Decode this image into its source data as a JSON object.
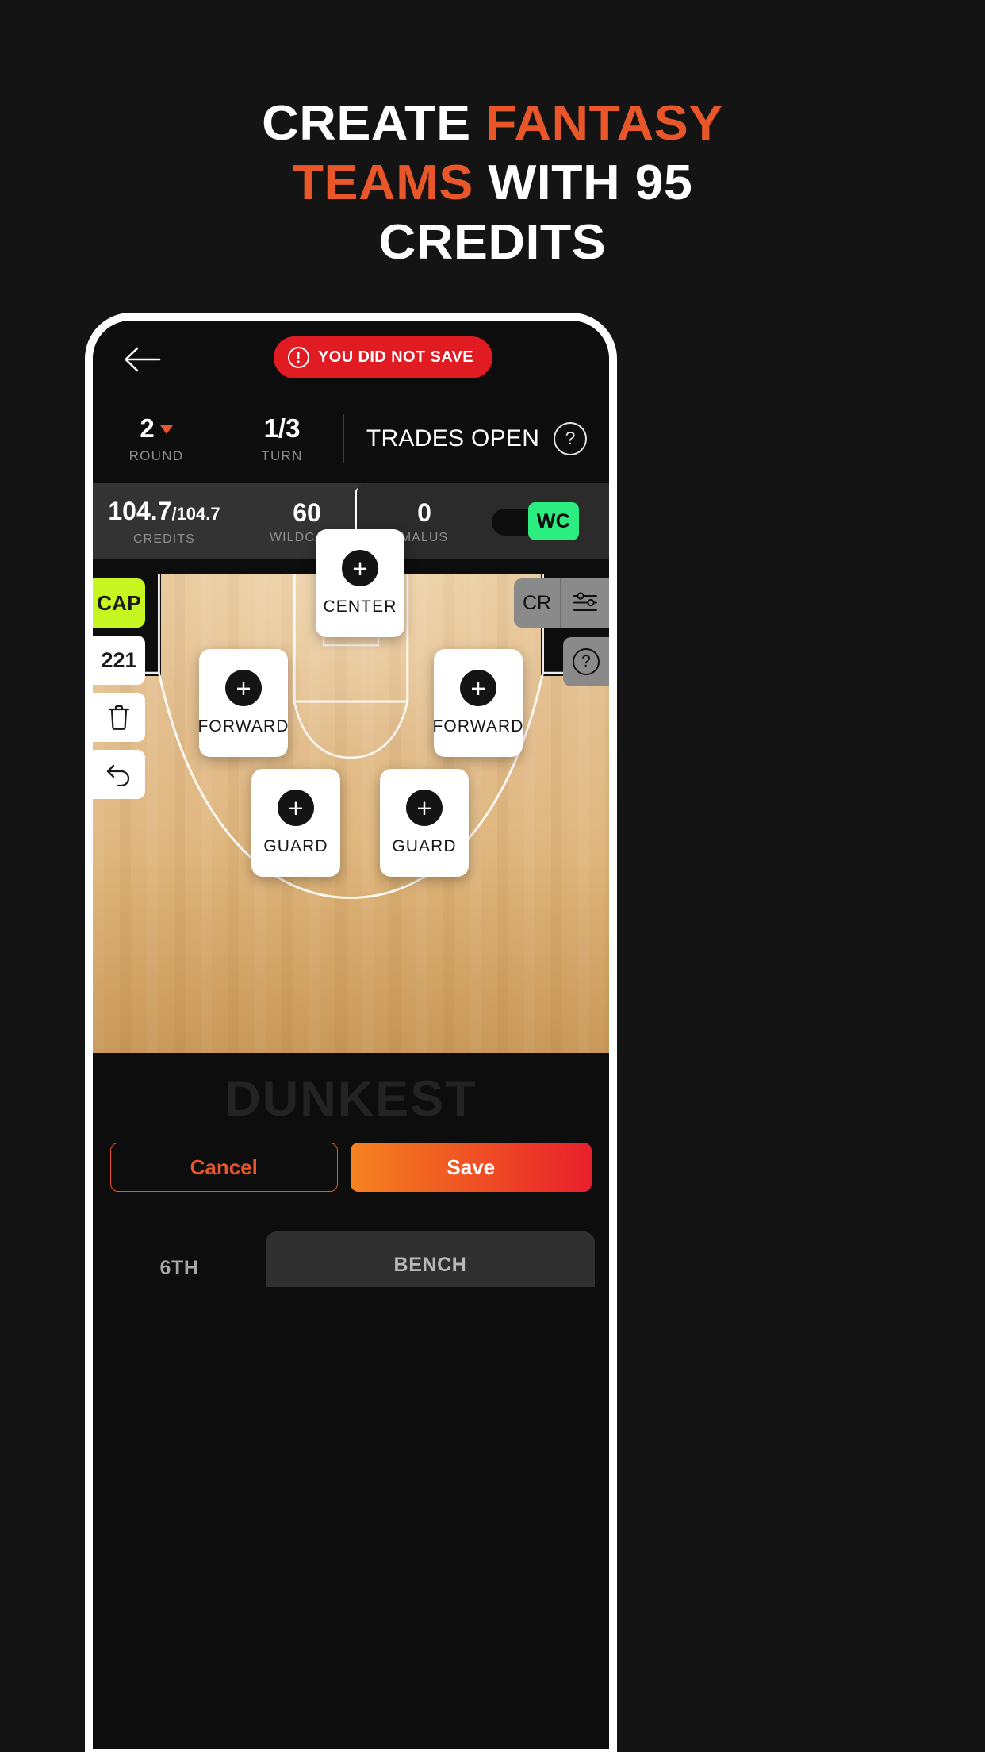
{
  "headline": {
    "line1_white": "CREATE ",
    "line1_accent": "FANTASY",
    "line2_accent": "TEAMS ",
    "line2_white": "WITH 95",
    "line3_white": "CREDITS",
    "accent_color": "#e8562a"
  },
  "app": {
    "topbar": {
      "back_icon": "back-arrow-icon",
      "save_banner": {
        "icon": "warning-icon",
        "label": "YOU DID NOT SAVE",
        "color": "#e01b22"
      }
    },
    "stats": {
      "round": {
        "value": "2",
        "label": "ROUND",
        "caret": "chevron-down-icon"
      },
      "turn": {
        "value": "1/3",
        "label": "TURN"
      },
      "trades": "TRADES OPEN",
      "help_icon": "?"
    },
    "credits": {
      "credits_value": "104.7",
      "credits_max": "/104.7",
      "credits_label": "CREDITS",
      "wildcard_value": "60",
      "wildcard_label": "WILDCARD",
      "add_button": "+",
      "malus_value": "0",
      "malus_label": "MALUS",
      "wc_toggle_label": "WC",
      "wc_toggle_color": "#2bed80"
    },
    "side_left": {
      "cap": "CAP",
      "number": "221",
      "trash_icon": "trash-icon",
      "undo_icon": "undo-icon",
      "cap_color": "#c6f622"
    },
    "side_right": {
      "cr": "CR",
      "sliders_icon": "sliders-icon",
      "help": "?"
    },
    "roster": [
      {
        "position": "center",
        "role": "CENTER",
        "add": "+"
      },
      {
        "position": "forward_left",
        "role": "FORWARD",
        "add": "+"
      },
      {
        "position": "forward_right",
        "role": "FORWARD",
        "add": "+"
      },
      {
        "position": "guard_left",
        "role": "GUARD",
        "add": "+"
      },
      {
        "position": "guard_right",
        "role": "GUARD",
        "add": "+"
      }
    ],
    "watermark": "DUNKEST",
    "footer": {
      "cancel": "Cancel",
      "save": "Save"
    },
    "bottom_tabs": {
      "sixth": "6TH",
      "bench": "BENCH"
    }
  }
}
